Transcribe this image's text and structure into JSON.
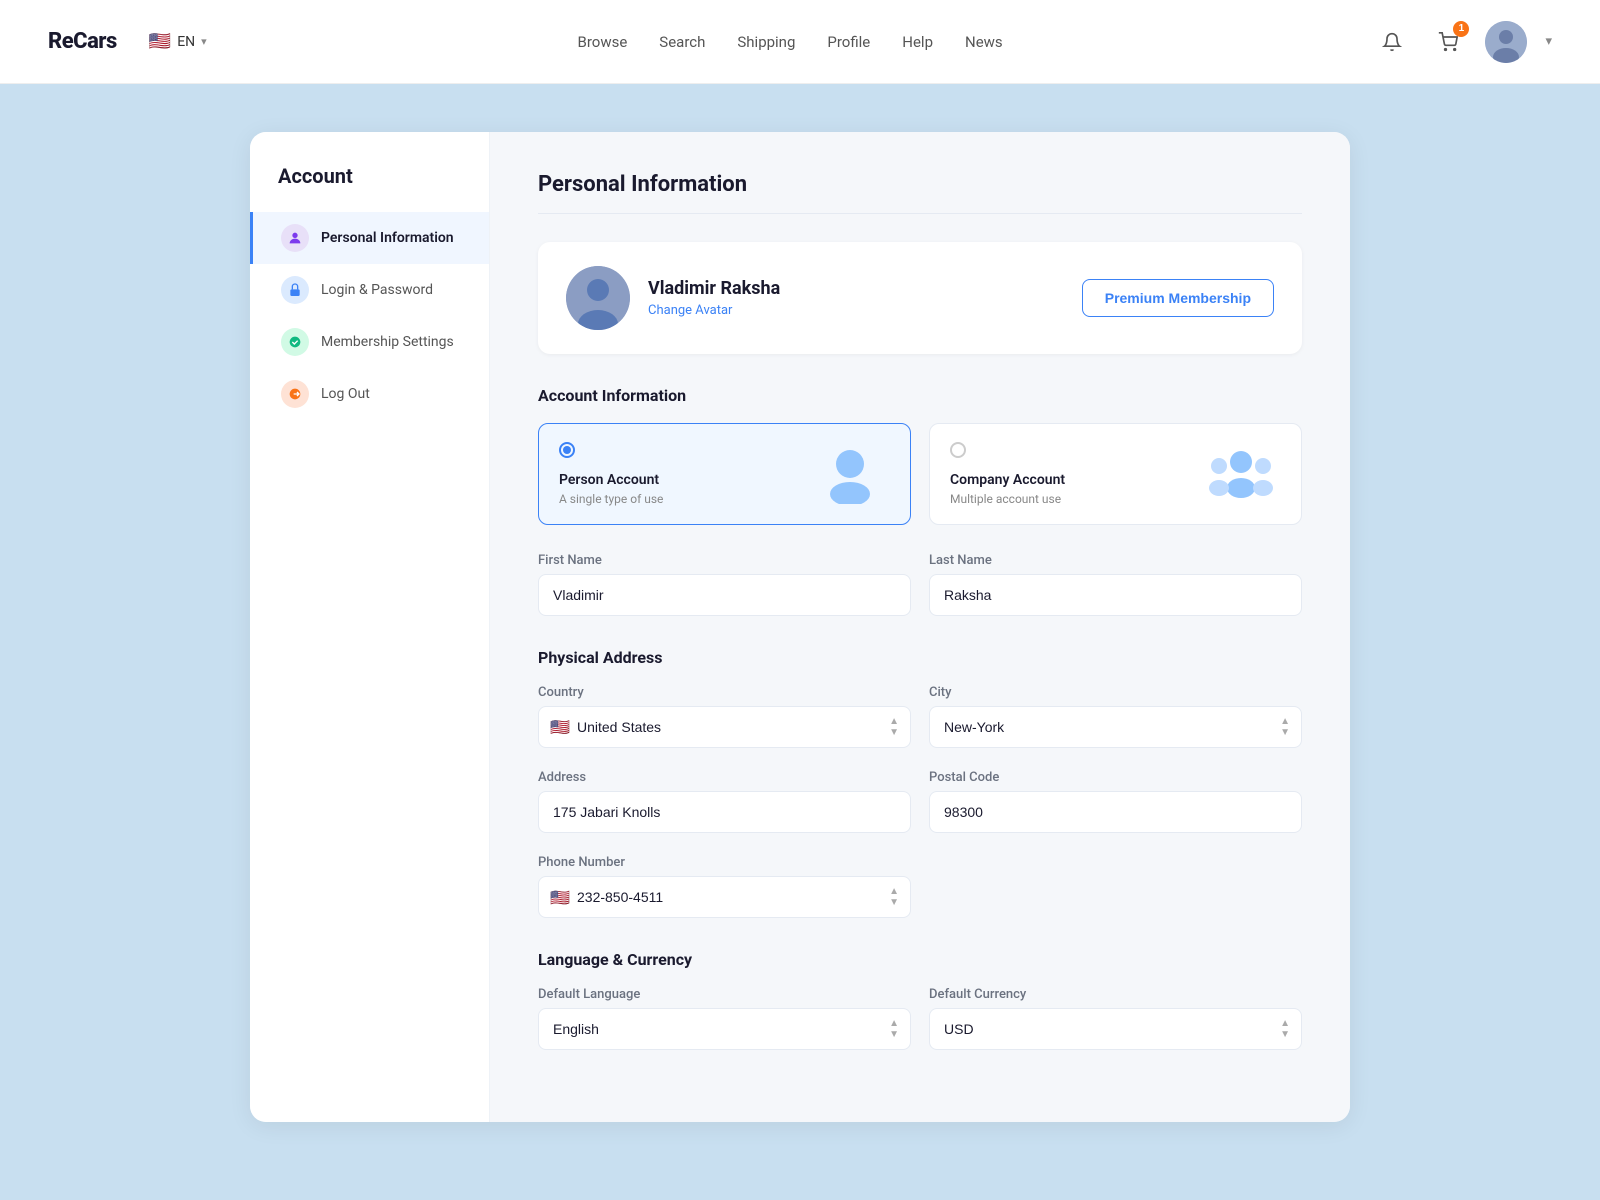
{
  "header": {
    "logo": "ReCars",
    "lang": "EN",
    "nav": [
      "Browse",
      "Search",
      "Shipping",
      "Profile",
      "Help",
      "News"
    ],
    "cart_badge": "1"
  },
  "sidebar": {
    "title": "Account",
    "items": [
      {
        "label": "Personal Information",
        "icon": "person-icon",
        "icon_class": "si-purple",
        "active": true
      },
      {
        "label": "Login & Password",
        "icon": "lock-icon",
        "icon_class": "si-blue",
        "active": false
      },
      {
        "label": "Membership Settings",
        "icon": "membership-icon",
        "icon_class": "si-green",
        "active": false
      },
      {
        "label": "Log Out",
        "icon": "logout-icon",
        "icon_class": "si-orange",
        "active": false
      }
    ]
  },
  "main": {
    "page_title": "Personal Information",
    "profile": {
      "name": "Vladimir Raksha",
      "change_avatar": "Change Avatar",
      "premium_btn": "Premium Membership"
    },
    "account_info": {
      "section_title": "Account Information",
      "types": [
        {
          "name": "Person Account",
          "desc": "A single type of use",
          "selected": true
        },
        {
          "name": "Company Account",
          "desc": "Multiple account use",
          "selected": false
        }
      ]
    },
    "name_fields": {
      "first_name_label": "First Name",
      "first_name_value": "Vladimir",
      "last_name_label": "Last Name",
      "last_name_value": "Raksha"
    },
    "physical_address": {
      "section_title": "Physical Address",
      "country_label": "Country",
      "country_value": "United States",
      "city_label": "City",
      "city_value": "New-York",
      "address_label": "Address",
      "address_value": "175 Jabari Knolls",
      "postal_label": "Postal Code",
      "postal_value": "98300",
      "phone_label": "Phone Number",
      "phone_value": "232-850-4511"
    },
    "language_currency": {
      "section_title": "Language & Currency",
      "lang_label": "Default Language",
      "lang_value": "English",
      "currency_label": "Default Currency",
      "currency_value": "USD"
    }
  }
}
